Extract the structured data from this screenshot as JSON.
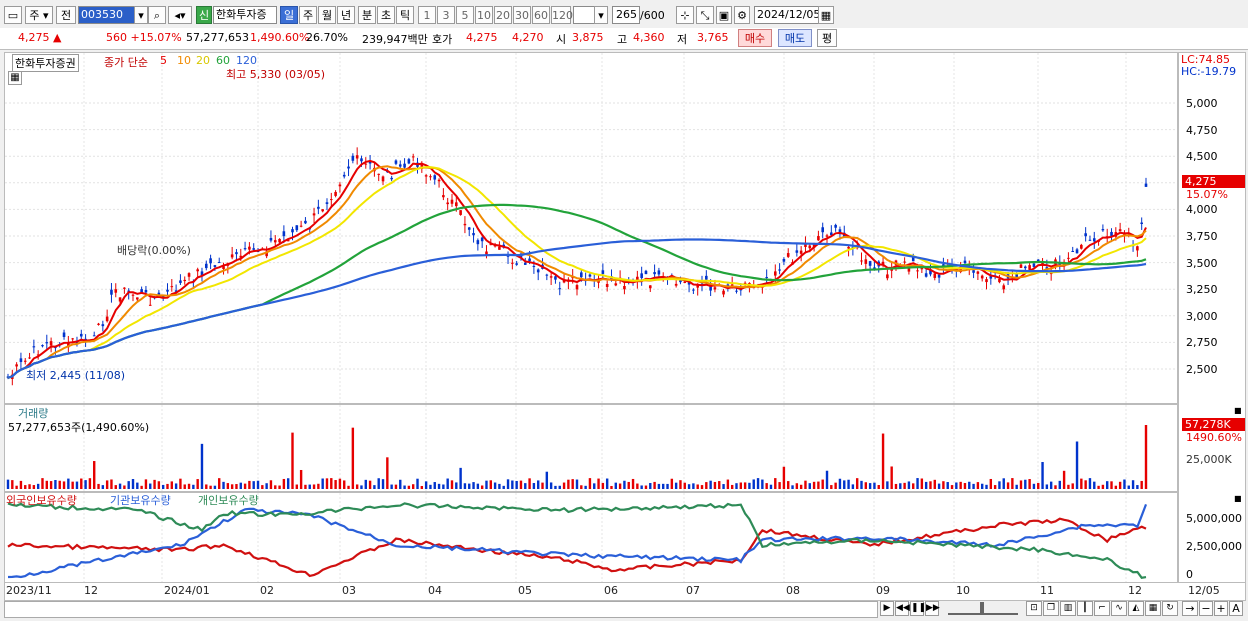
{
  "toolbar": {
    "market_kind": "주",
    "prev_label": "전",
    "code": "003530",
    "stock_name": "한화투자증",
    "shin_badge": "신",
    "periods": [
      "일",
      "주",
      "월",
      "년",
      "분",
      "초",
      "틱"
    ],
    "active_period": "일",
    "counts": [
      "1",
      "3",
      "5",
      "10",
      "20",
      "30",
      "60",
      "120"
    ],
    "range_value": "265",
    "range_total": "/600",
    "date": "2024/12/05",
    "colors": {
      "active": "#3b6fd6",
      "up": "#e60000",
      "down": "#0033cc"
    }
  },
  "info": {
    "price": "4,275 ▲",
    "change": "560 +15.07%",
    "volume": "57,277,653",
    "volume_pct": "1,490.60%",
    "turnover": "26.70%",
    "amount": "239,947백만",
    "quote_label": "호가",
    "quote_ask": "4,275",
    "quote_bid": "4,270",
    "open_label": "시",
    "open": "3,875",
    "high_label": "고",
    "high": "4,360",
    "low_label": "저",
    "low": "3,765",
    "buy_label": "매수",
    "sell_label": "매도",
    "eval_label": "평"
  },
  "price_panel": {
    "stock_label": "한화투자증권",
    "ma_title": "종가 단순",
    "ma_periods": [
      "5",
      "10",
      "20",
      "60",
      "120"
    ],
    "ma_colors": [
      "#e60000",
      "#f08a00",
      "#f2e600",
      "#22a33a",
      "#2a5fd8"
    ],
    "high_marker": "최고 5,330 (03/05)",
    "low_marker": "최저 2,445 (11/08)",
    "dividend_marker": "배당락(0.00%)",
    "lc": "LC:74.85",
    "hc": "HC:-19.79",
    "y_ticks": [
      "5,000",
      "4,750",
      "4,500",
      "4,250",
      "4,000",
      "3,750",
      "3,500",
      "3,250",
      "3,000",
      "2,750",
      "2,500"
    ],
    "last_price": "4,275",
    "last_pct": "15.07%"
  },
  "volume_panel": {
    "title": "거래량",
    "value_text": "57,277,653주(1,490.60%)",
    "last_volume": "57,278K",
    "last_pct": "1490.60%",
    "y_tick": "25,000K"
  },
  "holding_panel": {
    "series_labels": [
      "외국인보유수량",
      "기관보유수량",
      "개인보유수량"
    ],
    "series_colors": [
      "#d01010",
      "#2a5fd8",
      "#2e8b57"
    ],
    "y_ticks": [
      "5,000,000",
      "2,500,000",
      "0"
    ]
  },
  "x_axis": [
    "2023/11",
    "12",
    "2024/01",
    "02",
    "03",
    "04",
    "05",
    "06",
    "07",
    "08",
    "09",
    "10",
    "11",
    "12",
    "12/05"
  ]
}
